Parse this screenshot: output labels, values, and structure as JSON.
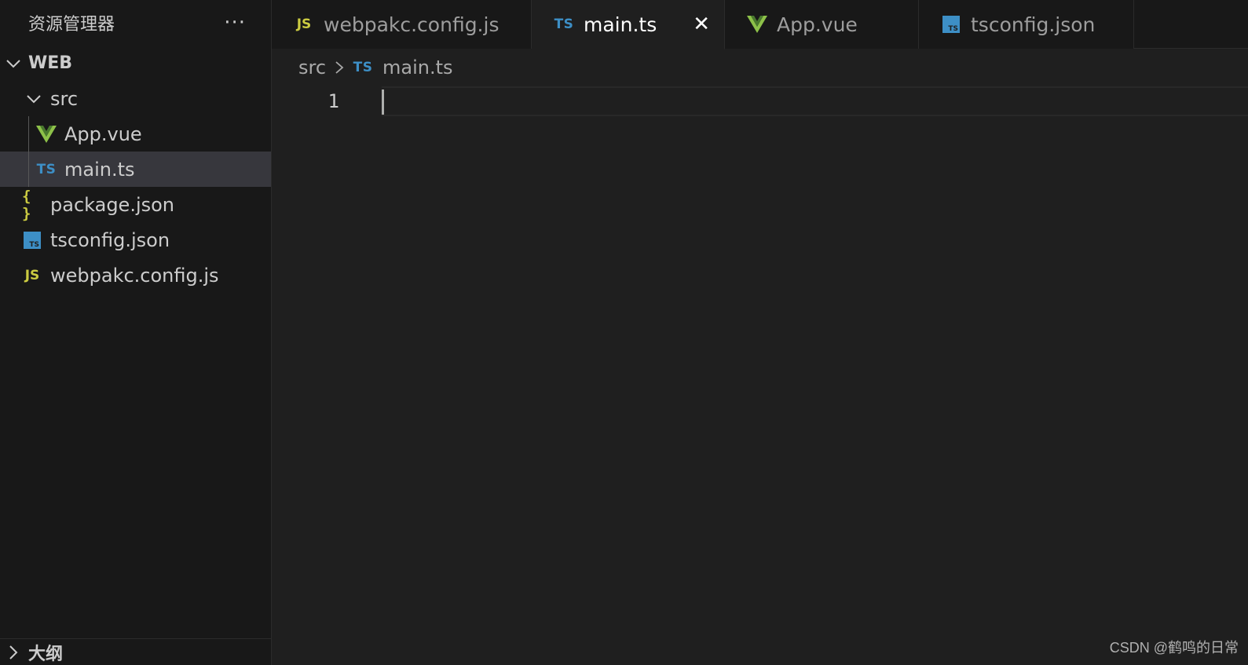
{
  "colors": {
    "background": "#1f1f1f",
    "sidebar": "#181818",
    "selection": "#37373d",
    "ts_blue": "#3d8fc6",
    "js_yellow": "#cbcb41",
    "vue_green": "#8dc149"
  },
  "explorer": {
    "title": "资源管理器",
    "more": "···",
    "root": {
      "label": "WEB",
      "icon": "chevron-down-icon"
    },
    "folder": {
      "label": "src",
      "icon": "chevron-down-icon"
    },
    "files": [
      {
        "label": "App.vue",
        "icon": "vue-icon"
      },
      {
        "label": "main.ts",
        "icon": "ts-icon",
        "icon_text": "TS",
        "selected": true
      },
      {
        "label": "package.json",
        "icon": "json-icon",
        "icon_text": "{ }"
      },
      {
        "label": "tsconfig.json",
        "icon": "tsconfig-icon",
        "icon_text": "TS"
      },
      {
        "label": "webpakc.config.js",
        "icon": "js-icon",
        "icon_text": "JS"
      }
    ],
    "outline": {
      "label": "大纲",
      "icon": "chevron-right-icon"
    }
  },
  "tabs": [
    {
      "label": "webpakc.config.js",
      "icon": "js-icon",
      "icon_text": "JS"
    },
    {
      "label": "main.ts",
      "icon": "ts-icon",
      "icon_text": "TS",
      "active": true,
      "close": "✕"
    },
    {
      "label": "App.vue",
      "icon": "vue-icon"
    },
    {
      "label": "tsconfig.json",
      "icon": "tsconfig-icon",
      "icon_text": "TS"
    }
  ],
  "breadcrumb": {
    "folder": "src",
    "file_icon_text": "TS",
    "file": "main.ts"
  },
  "editor": {
    "line_number": "1",
    "content": ""
  },
  "watermark": "CSDN @鹤鸣的日常"
}
